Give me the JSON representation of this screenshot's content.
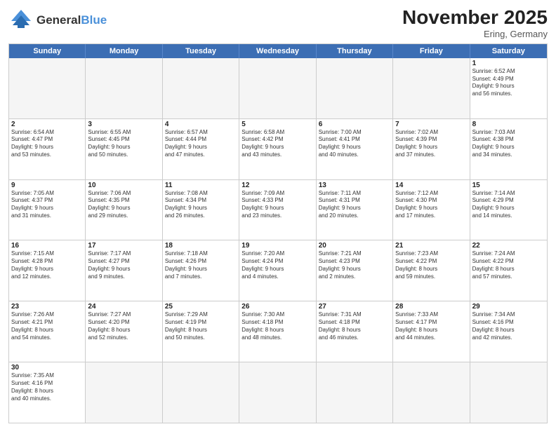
{
  "header": {
    "logo_general": "General",
    "logo_blue": "Blue",
    "month": "November 2025",
    "location": "Ering, Germany"
  },
  "weekdays": [
    "Sunday",
    "Monday",
    "Tuesday",
    "Wednesday",
    "Thursday",
    "Friday",
    "Saturday"
  ],
  "rows": [
    [
      {
        "day": "",
        "info": ""
      },
      {
        "day": "",
        "info": ""
      },
      {
        "day": "",
        "info": ""
      },
      {
        "day": "",
        "info": ""
      },
      {
        "day": "",
        "info": ""
      },
      {
        "day": "",
        "info": ""
      },
      {
        "day": "1",
        "info": "Sunrise: 6:52 AM\nSunset: 4:49 PM\nDaylight: 9 hours\nand 56 minutes."
      }
    ],
    [
      {
        "day": "2",
        "info": "Sunrise: 6:54 AM\nSunset: 4:47 PM\nDaylight: 9 hours\nand 53 minutes."
      },
      {
        "day": "3",
        "info": "Sunrise: 6:55 AM\nSunset: 4:45 PM\nDaylight: 9 hours\nand 50 minutes."
      },
      {
        "day": "4",
        "info": "Sunrise: 6:57 AM\nSunset: 4:44 PM\nDaylight: 9 hours\nand 47 minutes."
      },
      {
        "day": "5",
        "info": "Sunrise: 6:58 AM\nSunset: 4:42 PM\nDaylight: 9 hours\nand 43 minutes."
      },
      {
        "day": "6",
        "info": "Sunrise: 7:00 AM\nSunset: 4:41 PM\nDaylight: 9 hours\nand 40 minutes."
      },
      {
        "day": "7",
        "info": "Sunrise: 7:02 AM\nSunset: 4:39 PM\nDaylight: 9 hours\nand 37 minutes."
      },
      {
        "day": "8",
        "info": "Sunrise: 7:03 AM\nSunset: 4:38 PM\nDaylight: 9 hours\nand 34 minutes."
      }
    ],
    [
      {
        "day": "9",
        "info": "Sunrise: 7:05 AM\nSunset: 4:37 PM\nDaylight: 9 hours\nand 31 minutes."
      },
      {
        "day": "10",
        "info": "Sunrise: 7:06 AM\nSunset: 4:35 PM\nDaylight: 9 hours\nand 29 minutes."
      },
      {
        "day": "11",
        "info": "Sunrise: 7:08 AM\nSunset: 4:34 PM\nDaylight: 9 hours\nand 26 minutes."
      },
      {
        "day": "12",
        "info": "Sunrise: 7:09 AM\nSunset: 4:33 PM\nDaylight: 9 hours\nand 23 minutes."
      },
      {
        "day": "13",
        "info": "Sunrise: 7:11 AM\nSunset: 4:31 PM\nDaylight: 9 hours\nand 20 minutes."
      },
      {
        "day": "14",
        "info": "Sunrise: 7:12 AM\nSunset: 4:30 PM\nDaylight: 9 hours\nand 17 minutes."
      },
      {
        "day": "15",
        "info": "Sunrise: 7:14 AM\nSunset: 4:29 PM\nDaylight: 9 hours\nand 14 minutes."
      }
    ],
    [
      {
        "day": "16",
        "info": "Sunrise: 7:15 AM\nSunset: 4:28 PM\nDaylight: 9 hours\nand 12 minutes."
      },
      {
        "day": "17",
        "info": "Sunrise: 7:17 AM\nSunset: 4:27 PM\nDaylight: 9 hours\nand 9 minutes."
      },
      {
        "day": "18",
        "info": "Sunrise: 7:18 AM\nSunset: 4:26 PM\nDaylight: 9 hours\nand 7 minutes."
      },
      {
        "day": "19",
        "info": "Sunrise: 7:20 AM\nSunset: 4:24 PM\nDaylight: 9 hours\nand 4 minutes."
      },
      {
        "day": "20",
        "info": "Sunrise: 7:21 AM\nSunset: 4:23 PM\nDaylight: 9 hours\nand 2 minutes."
      },
      {
        "day": "21",
        "info": "Sunrise: 7:23 AM\nSunset: 4:22 PM\nDaylight: 8 hours\nand 59 minutes."
      },
      {
        "day": "22",
        "info": "Sunrise: 7:24 AM\nSunset: 4:22 PM\nDaylight: 8 hours\nand 57 minutes."
      }
    ],
    [
      {
        "day": "23",
        "info": "Sunrise: 7:26 AM\nSunset: 4:21 PM\nDaylight: 8 hours\nand 54 minutes."
      },
      {
        "day": "24",
        "info": "Sunrise: 7:27 AM\nSunset: 4:20 PM\nDaylight: 8 hours\nand 52 minutes."
      },
      {
        "day": "25",
        "info": "Sunrise: 7:29 AM\nSunset: 4:19 PM\nDaylight: 8 hours\nand 50 minutes."
      },
      {
        "day": "26",
        "info": "Sunrise: 7:30 AM\nSunset: 4:18 PM\nDaylight: 8 hours\nand 48 minutes."
      },
      {
        "day": "27",
        "info": "Sunrise: 7:31 AM\nSunset: 4:18 PM\nDaylight: 8 hours\nand 46 minutes."
      },
      {
        "day": "28",
        "info": "Sunrise: 7:33 AM\nSunset: 4:17 PM\nDaylight: 8 hours\nand 44 minutes."
      },
      {
        "day": "29",
        "info": "Sunrise: 7:34 AM\nSunset: 4:16 PM\nDaylight: 8 hours\nand 42 minutes."
      }
    ],
    [
      {
        "day": "30",
        "info": "Sunrise: 7:35 AM\nSunset: 4:16 PM\nDaylight: 8 hours\nand 40 minutes."
      },
      {
        "day": "",
        "info": ""
      },
      {
        "day": "",
        "info": ""
      },
      {
        "day": "",
        "info": ""
      },
      {
        "day": "",
        "info": ""
      },
      {
        "day": "",
        "info": ""
      },
      {
        "day": "",
        "info": ""
      }
    ]
  ]
}
